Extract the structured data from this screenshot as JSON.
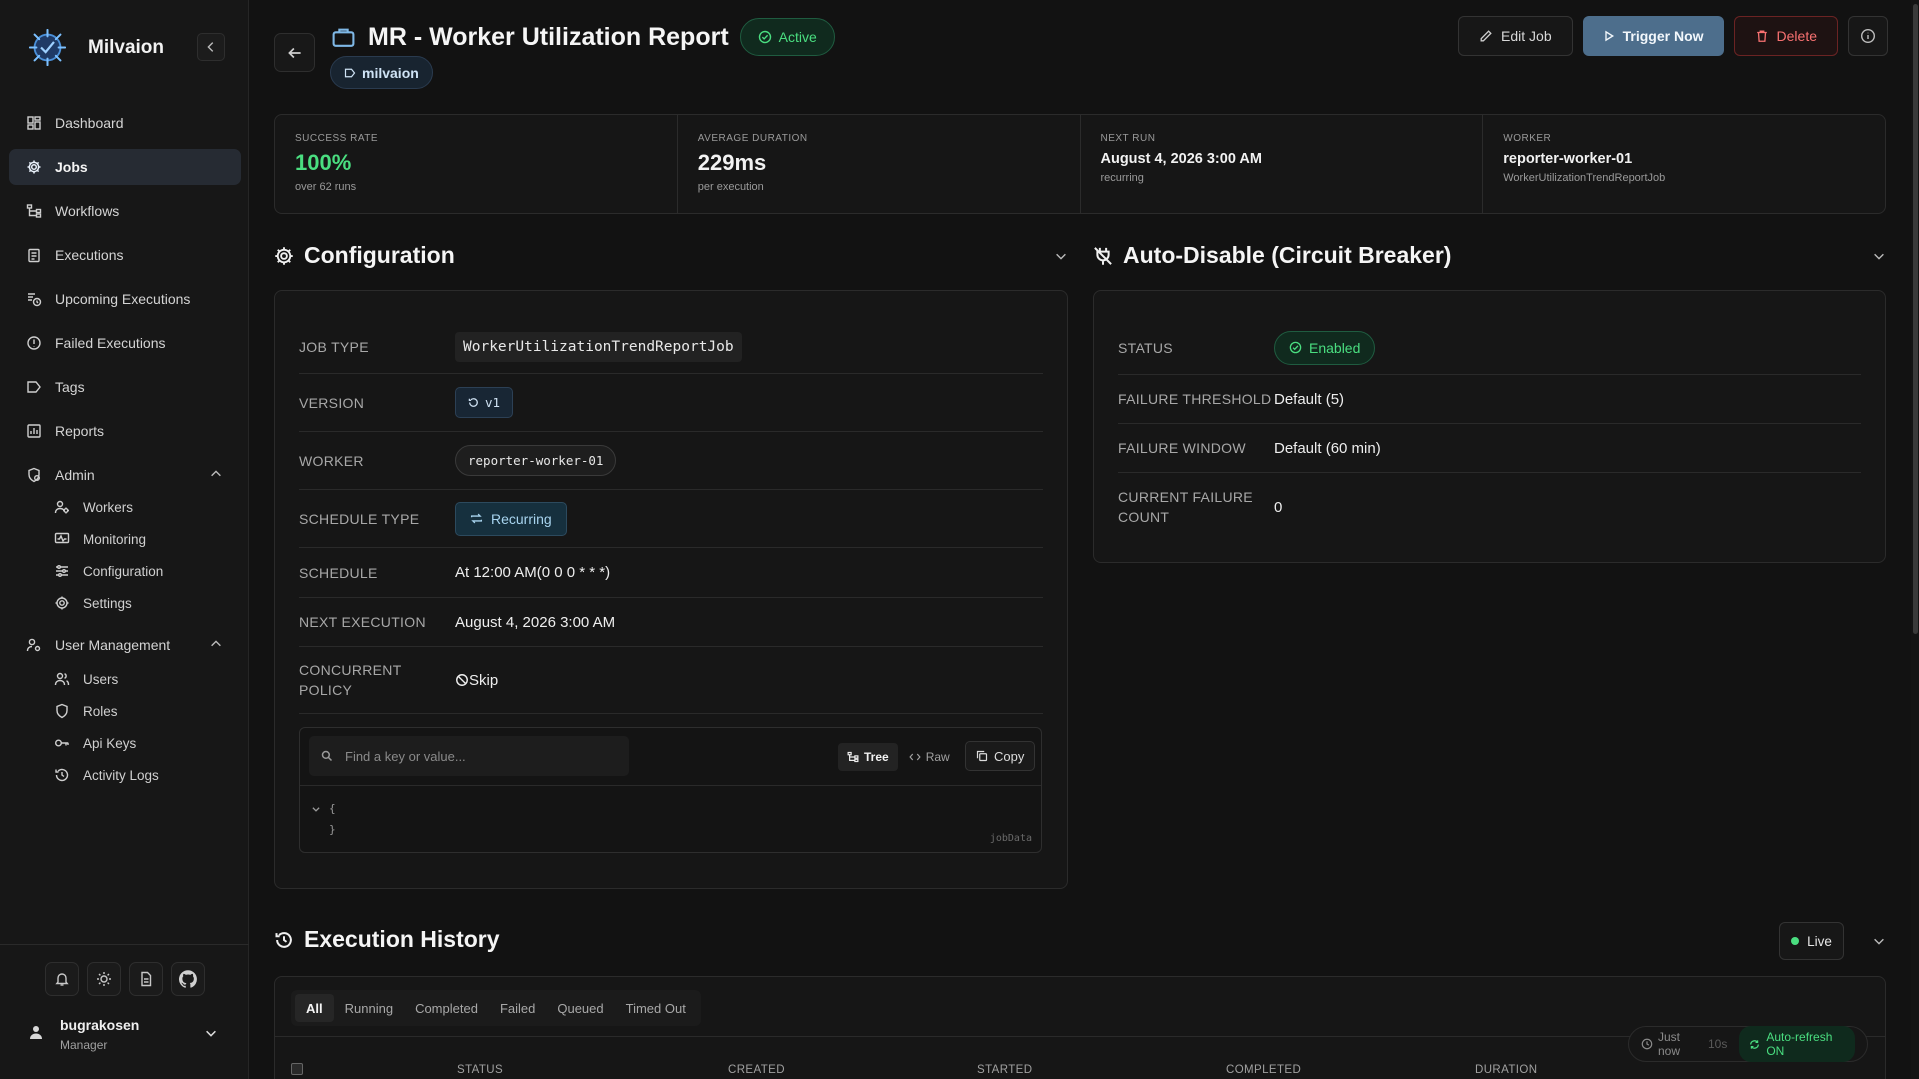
{
  "app": {
    "name": "Milvaion"
  },
  "sidebar": {
    "items": [
      {
        "label": "Dashboard"
      },
      {
        "label": "Jobs"
      },
      {
        "label": "Workflows"
      },
      {
        "label": "Executions"
      },
      {
        "label": "Upcoming Executions"
      },
      {
        "label": "Failed Executions"
      },
      {
        "label": "Tags"
      },
      {
        "label": "Reports"
      }
    ],
    "admin": {
      "label": "Admin",
      "children": [
        {
          "label": "Workers"
        },
        {
          "label": "Monitoring"
        },
        {
          "label": "Configuration"
        },
        {
          "label": "Settings"
        }
      ]
    },
    "user_management": {
      "label": "User Management",
      "children": [
        {
          "label": "Users"
        },
        {
          "label": "Roles"
        },
        {
          "label": "Api Keys"
        },
        {
          "label": "Activity Logs"
        }
      ]
    },
    "user": {
      "name": "bugrakosen",
      "role": "Manager"
    }
  },
  "header": {
    "title": "MR - Worker Utilization Report",
    "status": "Active",
    "tag": "milvaion",
    "actions": {
      "edit": "Edit Job",
      "trigger": "Trigger Now",
      "delete": "Delete"
    }
  },
  "stats": [
    {
      "label": "SUCCESS RATE",
      "value": "100%",
      "sub": "over 62 runs"
    },
    {
      "label": "AVERAGE DURATION",
      "value": "229ms",
      "sub": "per execution"
    },
    {
      "label": "NEXT RUN",
      "value": "August 4, 2026 3:00 AM",
      "sub": "recurring"
    },
    {
      "label": "WORKER",
      "value": "reporter-worker-01",
      "sub": "WorkerUtilizationTrendReportJob"
    }
  ],
  "configuration": {
    "title": "Configuration",
    "rows": {
      "job_type": {
        "label": "JOB TYPE",
        "value": "WorkerUtilizationTrendReportJob"
      },
      "version": {
        "label": "VERSION",
        "value": "v1"
      },
      "worker": {
        "label": "WORKER",
        "value": "reporter-worker-01"
      },
      "schedule_type": {
        "label": "SCHEDULE TYPE",
        "value": "Recurring"
      },
      "schedule": {
        "label": "SCHEDULE",
        "value": "At 12:00 AM(0 0 0 * * *)"
      },
      "next_execution": {
        "label": "NEXT EXECUTION",
        "value": "August 4, 2026 3:00 AM"
      },
      "concurrent_policy": {
        "label_line1": "CONCURRENT",
        "label_line2": "POLICY",
        "value": "Skip"
      }
    },
    "json_viewer": {
      "search_placeholder": "Find a key or value...",
      "tree_label": "Tree",
      "raw_label": "Raw",
      "copy_label": "Copy",
      "open_brace": "{",
      "close_brace": "}",
      "name": "jobData"
    }
  },
  "auto_disable": {
    "title": "Auto-Disable (Circuit Breaker)",
    "rows": {
      "status": {
        "label": "STATUS",
        "value": "Enabled"
      },
      "failure_threshold": {
        "label": "FAILURE THRESHOLD",
        "value": "Default (5)"
      },
      "failure_window": {
        "label": "FAILURE WINDOW",
        "value": "Default (60 min)"
      },
      "current_failure_count": {
        "label_line1": "CURRENT FAILURE",
        "label_line2": "COUNT",
        "value": "0"
      }
    }
  },
  "execution_history": {
    "title": "Execution History",
    "live_label": "Live",
    "filters": [
      "All",
      "Running",
      "Completed",
      "Failed",
      "Queued",
      "Timed Out"
    ],
    "columns": [
      "STATUS",
      "CREATED",
      "STARTED",
      "COMPLETED",
      "DURATION"
    ],
    "refresh": {
      "last": "Just now",
      "interval": "10s",
      "auto": "Auto-refresh ON"
    }
  },
  "colors": {
    "accent": "#4d6e8c",
    "success": "#4ade80",
    "danger": "#f87171",
    "background": "#121212"
  }
}
